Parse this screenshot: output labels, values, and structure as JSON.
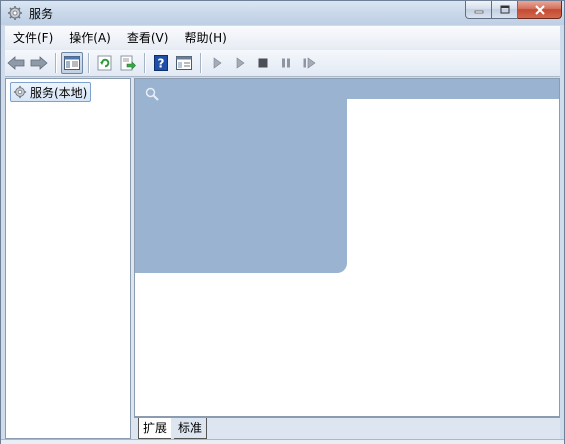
{
  "window": {
    "title": "服务",
    "icon": "gear-icon"
  },
  "menubar": {
    "items": [
      "文件(F)",
      "操作(A)",
      "查看(V)",
      "帮助(H)"
    ]
  },
  "toolbar": {
    "buttons": [
      {
        "icon": "back-arrow-icon"
      },
      {
        "icon": "forward-arrow-icon"
      },
      {
        "icon": "show-hide-console-tree-icon",
        "pressed": true
      },
      {
        "icon": "refresh-icon"
      },
      {
        "icon": "export-list-icon"
      },
      {
        "icon": "help-icon"
      },
      {
        "icon": "properties-icon"
      },
      {
        "icon": "start-service-icon"
      },
      {
        "icon": "start-service-alt-icon"
      },
      {
        "icon": "stop-service-icon"
      },
      {
        "icon": "pause-service-icon"
      },
      {
        "icon": "resume-service-icon"
      }
    ]
  },
  "tree": {
    "root_label": "服务(本地)",
    "root_icon": "gear-icon"
  },
  "main": {
    "header_icon": "search-icon"
  },
  "tabs": {
    "extended": "扩展",
    "standard": "标准",
    "active": "extended"
  },
  "colors": {
    "panel_blue": "#9ab3d0",
    "close_red": "#c34a31"
  }
}
